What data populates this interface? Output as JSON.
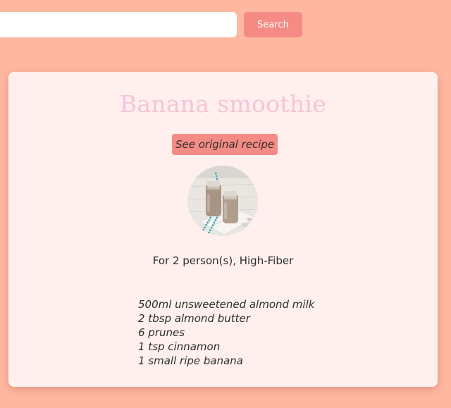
{
  "search": {
    "value": "",
    "placeholder": "",
    "button_label": "Search"
  },
  "recipe": {
    "title": "Banana smoothie",
    "original_link_label": "See original recipe",
    "image_alt": "banana smoothie bottles with striped straws",
    "servings_text": "For 2 person(s), High-Fiber",
    "ingredients": [
      "500ml unsweetened almond milk",
      "2 tbsp almond butter",
      "6 prunes",
      "1 tsp cinnamon",
      "1 small ripe banana"
    ]
  },
  "colors": {
    "page_background": "#ffb8a0",
    "card_background": "#fff0ed",
    "accent": "#f48b84",
    "title": "#f7c3d8",
    "text": "#2d2d2d"
  }
}
